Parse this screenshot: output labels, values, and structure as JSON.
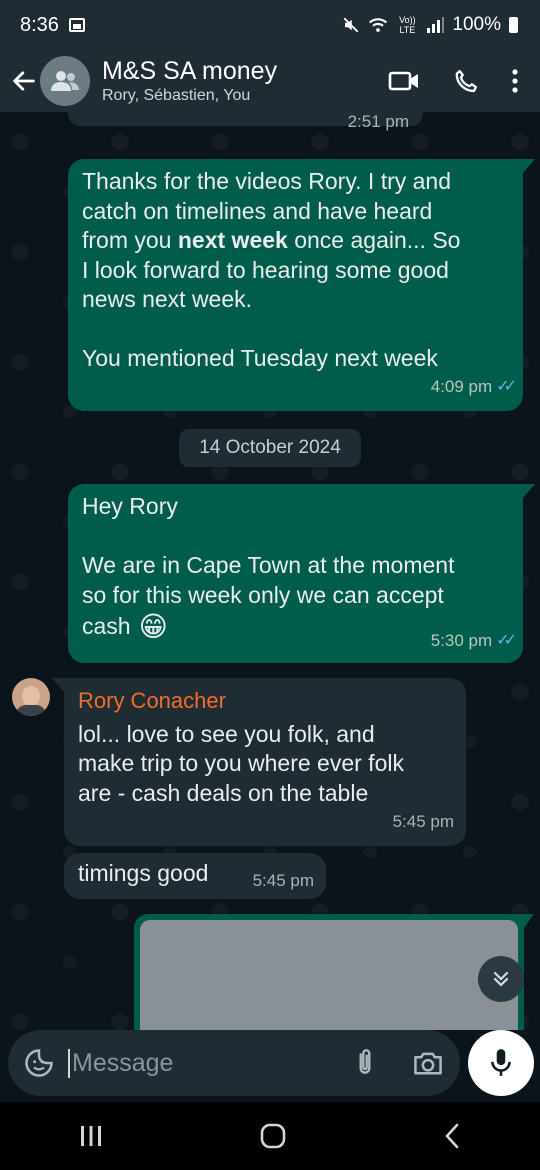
{
  "status_bar": {
    "time": "8:36",
    "network": "Vo)) LTE",
    "battery": "100%"
  },
  "header": {
    "title": "M&S SA money",
    "subtitle": "Rory, Sébastien, You"
  },
  "messages": {
    "partial_time": "2:51 pm",
    "m1": {
      "lines": [
        "Thanks for the videos Rory.  I try and",
        "catch on timelines and have heard",
        "from you ",
        "next week",
        " once again... So",
        "I look forward to hearing some good",
        "news next week.",
        "You mentioned Tuesday next week"
      ],
      "time": "4:09 pm"
    },
    "date_separator": "14 October 2024",
    "m2": {
      "line1": "Hey Rory",
      "line2": "We are in Cape Town at the moment",
      "line3": "so for this week only we can accept",
      "line4": "cash",
      "emoji": "😁",
      "time": "5:30 pm"
    },
    "m3": {
      "sender": "Rory Conacher",
      "line1": "lol... love to see you folk, and",
      "line2": "make trip to you where ever folk",
      "line3": "are - cash deals on the table",
      "time": "5:45 pm"
    },
    "m4": {
      "text": "timings good",
      "time": "5:45 pm"
    }
  },
  "input": {
    "placeholder": "Message"
  },
  "colors": {
    "outgoing_bubble": "#005c4b",
    "incoming_bubble": "#1f2c34",
    "sender_name": "#f26c2b",
    "read_ticks": "#53bdeb",
    "background": "#0b141a"
  }
}
